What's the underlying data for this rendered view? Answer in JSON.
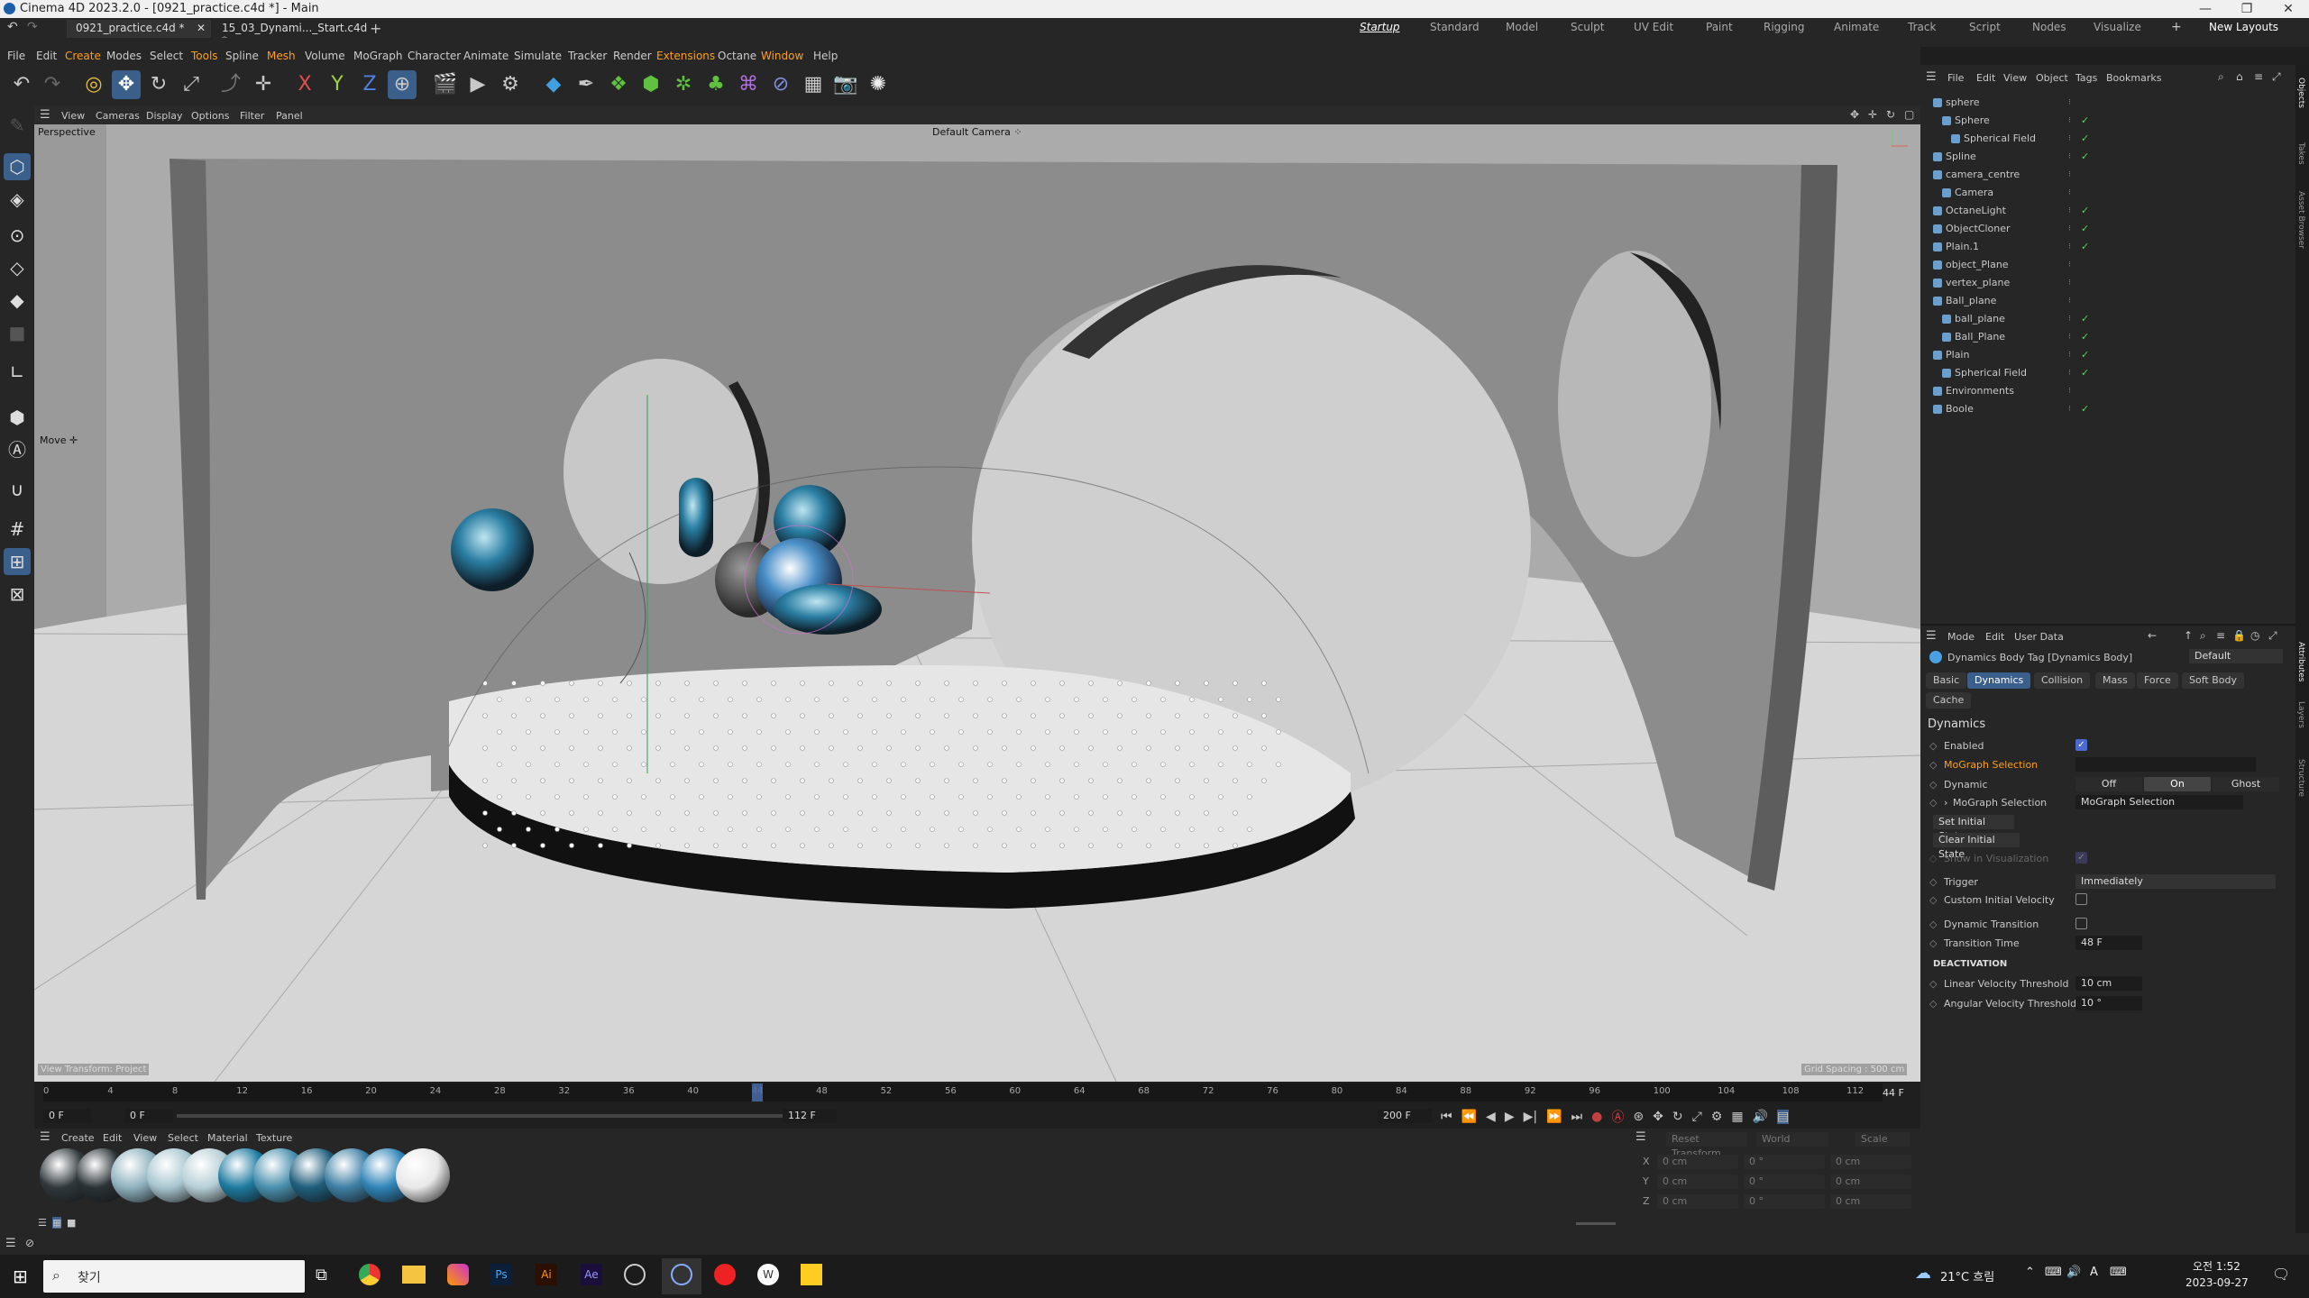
{
  "window": {
    "title": "Cinema 4D 2023.2.0 - [0921_practice.c4d *] - Main"
  },
  "tabs": [
    {
      "label": "0921_practice.c4d *"
    },
    {
      "label": "15_03_Dynami..._Start.c4d *"
    }
  ],
  "layouts": [
    "Startup",
    "Standard",
    "Model",
    "Sculpt",
    "UV Edit",
    "Paint",
    "Rigging",
    "Animate",
    "Track",
    "Script",
    "Nodes",
    "Visualize"
  ],
  "new_layouts": "New Layouts",
  "menus": [
    "File",
    "Edit",
    "Create",
    "Modes",
    "Select",
    "Tools",
    "Spline",
    "Mesh",
    "Volume",
    "MoGraph",
    "Character",
    "Animate",
    "Simulate",
    "Tracker",
    "Render",
    "Extensions",
    "Octane",
    "Window",
    "Help"
  ],
  "viewport": {
    "menus": [
      "View",
      "Cameras",
      "Display",
      "Options",
      "Filter",
      "Panel"
    ],
    "label": "Perspective",
    "camera": "Default Camera ⁘",
    "tool_label": "Move ✛",
    "bottom_left": "View Transform: Project",
    "grid_spacing": "Grid Spacing : 500 cm"
  },
  "timeline": {
    "ticks": [
      "0",
      "4",
      "8",
      "12",
      "16",
      "20",
      "24",
      "28",
      "32",
      "36",
      "40",
      "44",
      "48",
      "52",
      "56",
      "60",
      "64",
      "68",
      "72",
      "76",
      "80",
      "84",
      "88",
      "92",
      "96",
      "100",
      "104",
      "108",
      "112"
    ],
    "current_frame": "44 F",
    "start": "0 F",
    "start2": "0 F",
    "end_a": "112 F",
    "end_b": "200 F",
    "playhead_fraction": 0.393
  },
  "materials": {
    "menus": [
      "Create",
      "Edit",
      "View",
      "Select",
      "Material",
      "Texture"
    ],
    "colors": [
      "#30383c",
      "#2a3236",
      "#8fb2bf",
      "#a8c6d0",
      "#b7cfd7",
      "#1e7aa0",
      "#4a90ae",
      "#1f5e7c",
      "#3f7fa5",
      "#2f84b8",
      "#e8e8e8"
    ]
  },
  "coords": {
    "header": [
      "Reset Transform",
      "World",
      "Scale"
    ],
    "rows": [
      {
        "axis": "X",
        "a": "0 cm",
        "b": "0 °",
        "c": "0 cm"
      },
      {
        "axis": "Y",
        "a": "0 cm",
        "b": "0 °",
        "c": "0 cm"
      },
      {
        "axis": "Z",
        "a": "0 cm",
        "b": "0 °",
        "c": "0 cm"
      }
    ]
  },
  "objects": {
    "menus": [
      "File",
      "Edit",
      "View",
      "Object",
      "Tags",
      "Bookmarks"
    ],
    "items": [
      {
        "name": "sphere",
        "indent": 0,
        "check": ""
      },
      {
        "name": "Sphere",
        "indent": 1,
        "check": "✓"
      },
      {
        "name": "Spherical Field",
        "indent": 2,
        "check": "✓"
      },
      {
        "name": "Spline",
        "indent": 0,
        "check": "✓"
      },
      {
        "name": "camera_centre",
        "indent": 0,
        "check": ""
      },
      {
        "name": "Camera",
        "indent": 1,
        "check": ""
      },
      {
        "name": "OctaneLight",
        "indent": 0,
        "check": "✓"
      },
      {
        "name": "ObjectCloner",
        "indent": 0,
        "check": "✓"
      },
      {
        "name": "Plain.1",
        "indent": 0,
        "check": "✓"
      },
      {
        "name": "object_Plane",
        "indent": 0,
        "check": ""
      },
      {
        "name": "vertex_plane",
        "indent": 0,
        "check": ""
      },
      {
        "name": "Ball_plane",
        "indent": 0,
        "check": ""
      },
      {
        "name": "ball_plane",
        "indent": 1,
        "check": "✓"
      },
      {
        "name": "Ball_Plane",
        "indent": 1,
        "check": "✓"
      },
      {
        "name": "Plain",
        "indent": 0,
        "check": "✓"
      },
      {
        "name": "Spherical Field",
        "indent": 1,
        "check": "✓"
      },
      {
        "name": "Environments",
        "indent": 0,
        "check": ""
      },
      {
        "name": "Boole",
        "indent": 0,
        "check": "✓"
      }
    ]
  },
  "attributes": {
    "menus": [
      "Mode",
      "Edit",
      "User Data"
    ],
    "tag_title": "Dynamics Body Tag [Dynamics Body]",
    "preset": "Default",
    "tabs": [
      "Basic",
      "Dynamics",
      "Collision",
      "Mass",
      "Force",
      "Soft Body",
      "Cache"
    ],
    "section": "Dynamics",
    "enabled_label": "Enabled",
    "mograph_label": "MoGraph Selection",
    "dynamic_label": "Dynamic",
    "dynamic_opts": [
      "Off",
      "On",
      "Ghost"
    ],
    "mograph_sel_label": "MoGraph Selection",
    "mograph_sel_value": "MoGraph Selection",
    "set_initial": "Set Initial State",
    "clear_initial": "Clear Initial State",
    "show_vis": "Show in Visualization",
    "trigger_label": "Trigger",
    "trigger_value": "Immediately",
    "custom_vel": "Custom Initial Velocity",
    "dyn_trans": "Dynamic Transition",
    "trans_time": "Transition Time",
    "trans_time_val": "48 F",
    "deact": "DEACTIVATION",
    "lin_vel": "Linear Velocity Threshold",
    "lin_vel_val": "10 cm",
    "ang_vel": "Angular Velocity Threshold",
    "ang_vel_val": "10 °"
  },
  "right_strip": [
    "Objects",
    "Takes",
    "Asset Browser",
    "Attributes",
    "Layers",
    "Structure"
  ],
  "taskbar": {
    "search": "찾기",
    "weather": "21°C 흐림",
    "time": "오전 1:52",
    "date": "2023-09-27"
  }
}
